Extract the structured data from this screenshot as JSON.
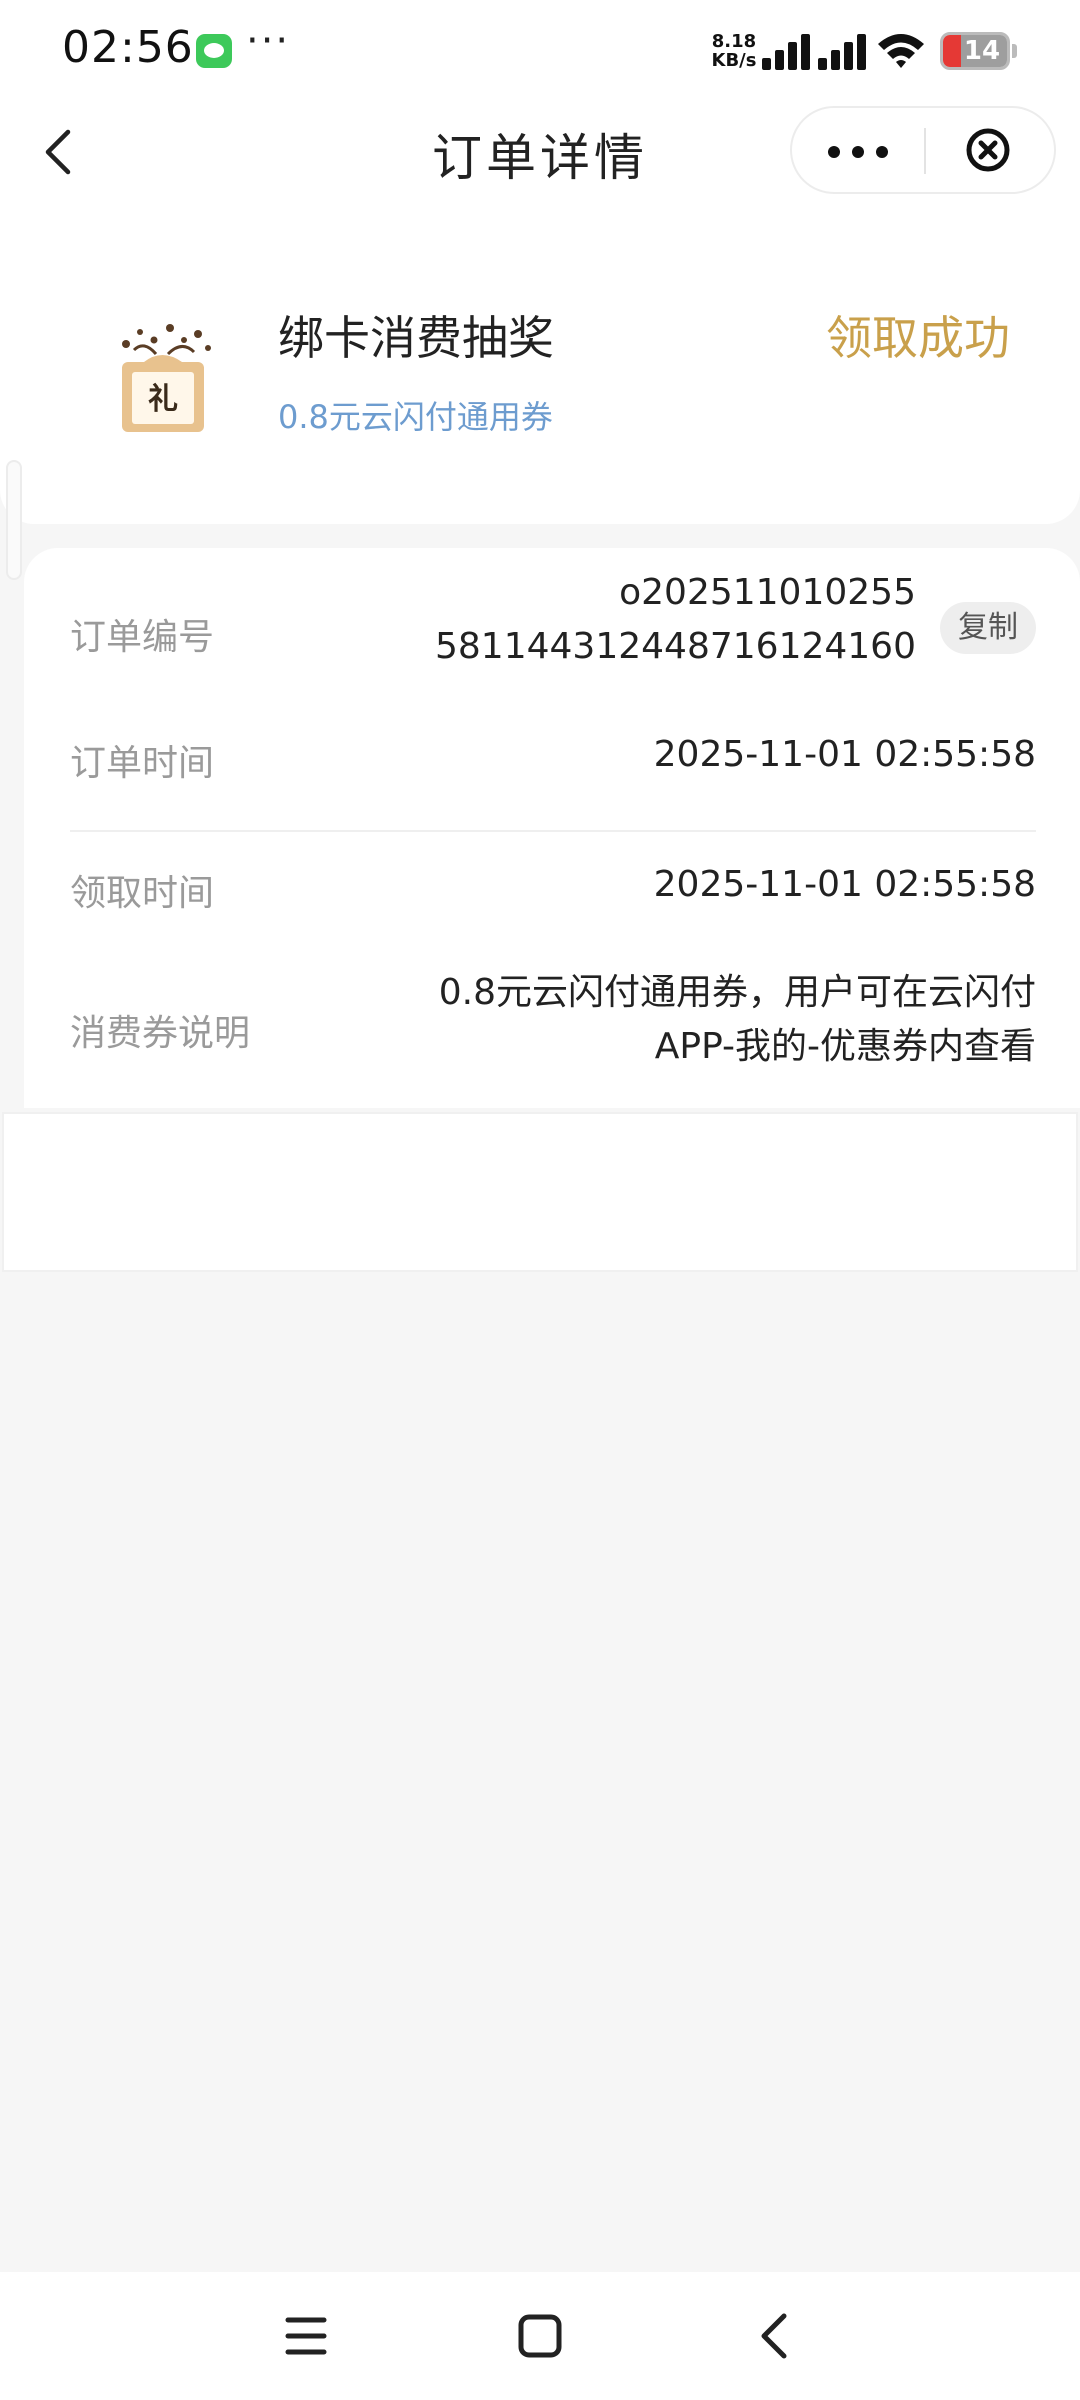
{
  "status_bar": {
    "time": "02:56",
    "more": "···",
    "net_speed_value": "8.18",
    "net_speed_unit": "KB/s",
    "battery": "14"
  },
  "nav": {
    "title": "订单详情"
  },
  "prize": {
    "title": "绑卡消费抽奖",
    "subtitle": "0.8元云闪付通用券",
    "status": "领取成功",
    "icon_glyph": "礼",
    "status_color": "#c9a04b",
    "subtitle_color": "#6d9ccf"
  },
  "details": {
    "order_no_label": "订单编号",
    "order_no_line1": "o202511010255",
    "order_no_line2": "5811443124487161 24160",
    "copy_label": "复制",
    "order_time_label": "订单时间",
    "order_time_value": "2025-11-01 02:55:58",
    "claim_time_label": "领取时间",
    "claim_time_value": "2025-11-01 02:55:58",
    "coupon_desc_label": "消费券说明",
    "coupon_desc_line1": "0.8元云闪付通用券，用户可在云闪付",
    "coupon_desc_line2": "APP-我的-优惠券内查看"
  }
}
